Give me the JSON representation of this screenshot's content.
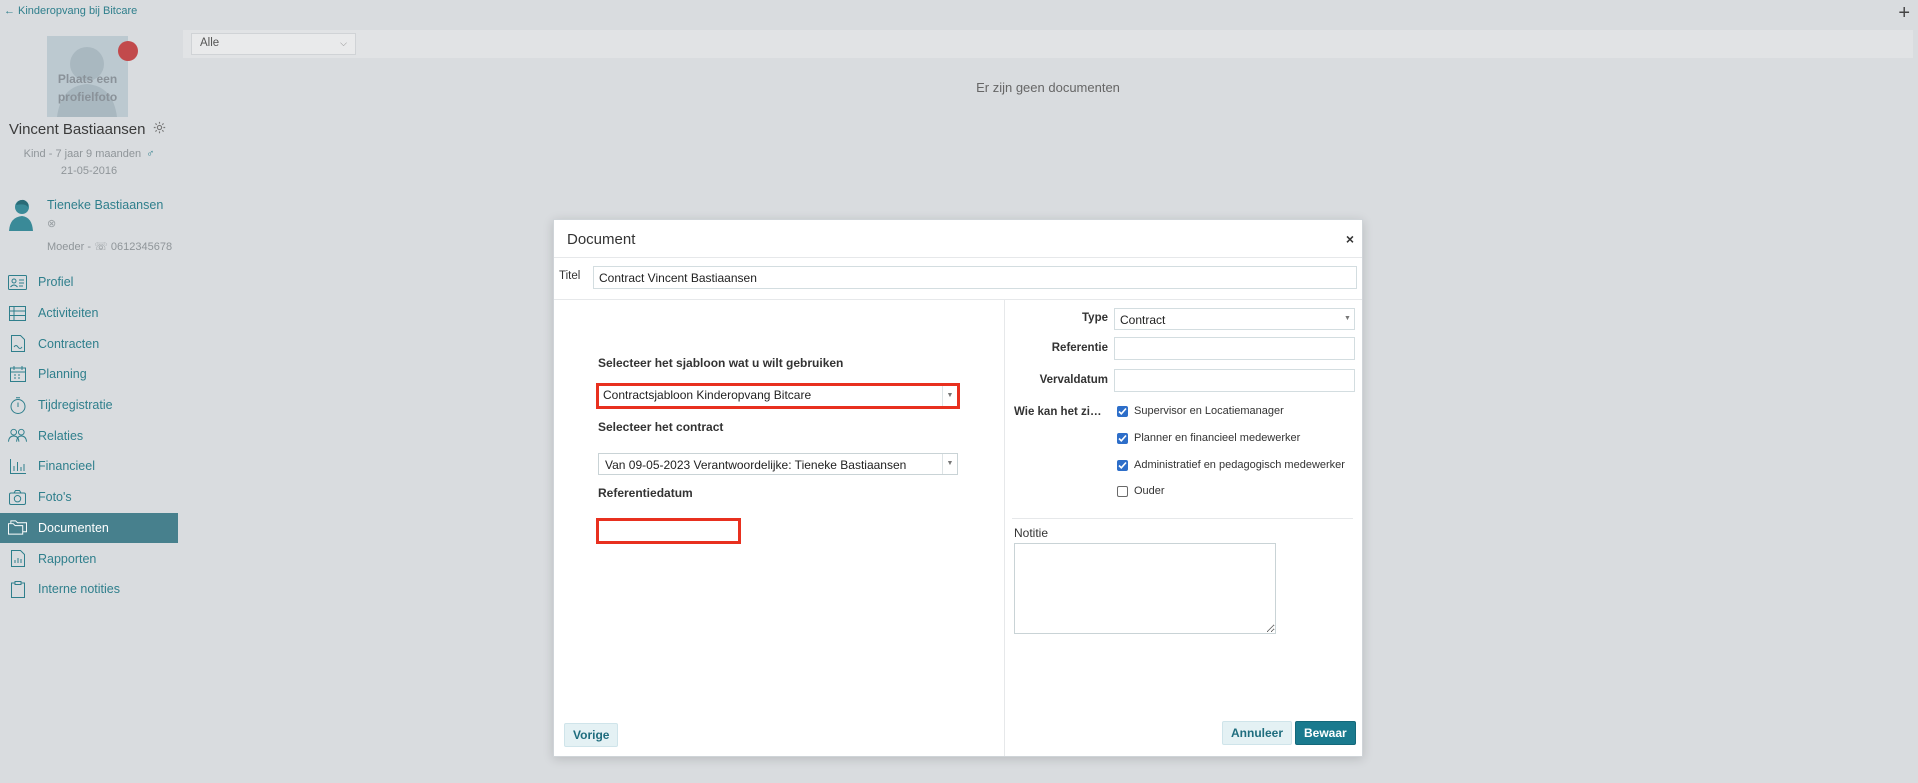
{
  "sidebar": {
    "back_label": "Kinderopvang bij Bitcare",
    "avatar_placeholder_line1": "Plaats een",
    "avatar_placeholder_line2": "profielfoto",
    "child_name": "Vincent Bastiaansen",
    "child_role_age": "Kind - 7 jaar 9 maanden",
    "child_gender_icon": "♂",
    "child_birthdate": "21-05-2016",
    "parent_name": "Tieneke Bastiaansen",
    "parent_role": "Moeder -",
    "parent_phone": "0612345678",
    "nav": [
      {
        "label": "Profiel",
        "icon": "profile-card-icon"
      },
      {
        "label": "Activiteiten",
        "icon": "table-icon"
      },
      {
        "label": "Contracten",
        "icon": "contract-icon"
      },
      {
        "label": "Planning",
        "icon": "calendar-icon"
      },
      {
        "label": "Tijdregistratie",
        "icon": "stopwatch-icon"
      },
      {
        "label": "Relaties",
        "icon": "people-icon"
      },
      {
        "label": "Financieel",
        "icon": "bar-chart-icon"
      },
      {
        "label": "Foto's",
        "icon": "camera-icon"
      },
      {
        "label": "Documenten",
        "icon": "folder-icon"
      },
      {
        "label": "Rapporten",
        "icon": "report-icon"
      },
      {
        "label": "Interne notities",
        "icon": "clipboard-icon"
      }
    ],
    "active_item": "Documenten"
  },
  "main": {
    "filter_value": "Alle",
    "empty_message": "Er zijn geen documenten",
    "add_label": "+"
  },
  "modal": {
    "title": "Document",
    "close_label": "×",
    "titel_label": "Titel",
    "titel_value": "Contract Vincent Bastiaansen",
    "template_label": "Selecteer het sjabloon wat u wilt gebruiken",
    "template_value": "Contractsjabloon Kinderopvang Bitcare",
    "contract_label": "Selecteer het contract",
    "contract_value": "Van 09-05-2023 Verantwoordelijke: Tieneke Bastiaansen",
    "refdate_label": "Referentiedatum",
    "refdate_value": "",
    "type_label": "Type",
    "type_value": "Contract",
    "referentie_label": "Referentie",
    "referentie_value": "",
    "vervaldatum_label": "Vervaldatum",
    "vervaldatum_value": "",
    "visibility_label": "Wie kan het zi…",
    "visibility_options": [
      {
        "label": "Supervisor en Locatiemanager",
        "checked": true
      },
      {
        "label": "Planner en financieel medewerker",
        "checked": true
      },
      {
        "label": "Administratief en pedagogisch medewerker",
        "checked": true
      },
      {
        "label": "Ouder",
        "checked": false
      }
    ],
    "notitie_label": "Notitie",
    "notitie_value": "",
    "prev_button": "Vorige",
    "cancel_button": "Annuleer",
    "save_button": "Bewaar"
  },
  "colors": {
    "accent": "#2f7f8c",
    "active_nav_bg": "#47808d",
    "highlight_border": "#e8301f",
    "primary_button": "#1a7a8e",
    "status_dot": "#c24a4c"
  }
}
